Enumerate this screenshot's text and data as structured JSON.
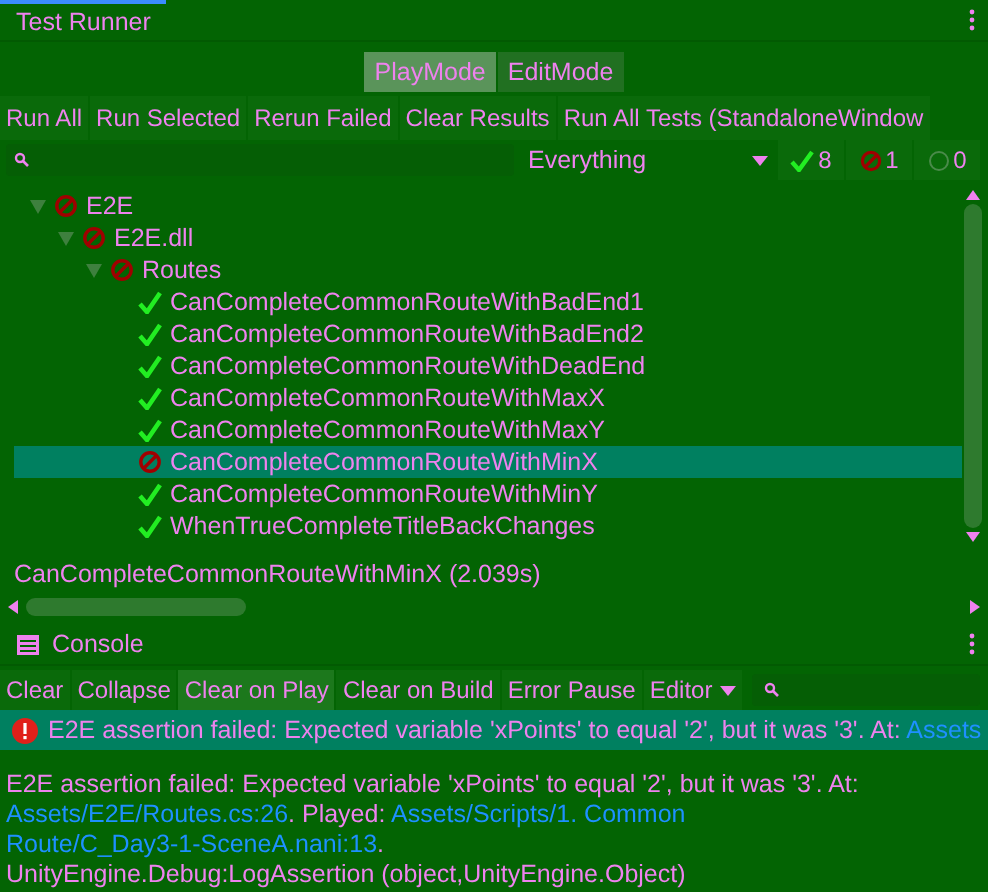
{
  "test_runner": {
    "tab": "Test Runner",
    "modes": [
      {
        "label": "PlayMode",
        "selected": true
      },
      {
        "label": "EditMode",
        "selected": false
      }
    ],
    "toolbar": [
      "Run All",
      "Run Selected",
      "Rerun Failed",
      "Clear Results",
      "Run All Tests (StandaloneWindow"
    ],
    "filter": {
      "dropdown": "Everything",
      "passed_count": "8",
      "failed_count": "1",
      "skipped_count": "0"
    },
    "tree": [
      {
        "label": "E2E",
        "passed": false,
        "expanded": true,
        "selected": false,
        "children": [
          {
            "label": "E2E.dll",
            "passed": false,
            "expanded": true,
            "selected": false,
            "children": [
              {
                "label": "Routes",
                "passed": false,
                "expanded": true,
                "selected": false,
                "children": [
                  {
                    "label": "CanCompleteCommonRouteWithBadEnd1",
                    "passed": true,
                    "selected": false
                  },
                  {
                    "label": "CanCompleteCommonRouteWithBadEnd2",
                    "passed": true,
                    "selected": false
                  },
                  {
                    "label": "CanCompleteCommonRouteWithDeadEnd",
                    "passed": true,
                    "selected": false
                  },
                  {
                    "label": "CanCompleteCommonRouteWithMaxX",
                    "passed": true,
                    "selected": false
                  },
                  {
                    "label": "CanCompleteCommonRouteWithMaxY",
                    "passed": true,
                    "selected": false
                  },
                  {
                    "label": "CanCompleteCommonRouteWithMinX",
                    "passed": false,
                    "selected": true
                  },
                  {
                    "label": "CanCompleteCommonRouteWithMinY",
                    "passed": true,
                    "selected": false
                  },
                  {
                    "label": "WhenTrueCompleteTitleBackChanges",
                    "passed": true,
                    "selected": false
                  }
                ]
              }
            ]
          }
        ]
      }
    ],
    "status_line": "CanCompleteCommonRouteWithMinX (2.039s)"
  },
  "console": {
    "tab": "Console",
    "toolbar": [
      {
        "label": "Clear",
        "on": false
      },
      {
        "label": "Collapse",
        "on": false
      },
      {
        "label": "Clear on Play",
        "on": true
      },
      {
        "label": "Clear on Build",
        "on": false
      },
      {
        "label": "Error Pause",
        "on": false
      }
    ],
    "editor_dropdown": "Editor",
    "entries": [
      {
        "kind": "error",
        "selected": true,
        "parts": [
          {
            "kind": "text",
            "text": "E2E assertion failed: Expected variable 'xPoints' to equal '2', but it was '3'. At: "
          },
          {
            "kind": "link",
            "text": "Assets"
          }
        ]
      }
    ],
    "detail": [
      {
        "kind": "text",
        "text": "E2E assertion failed: Expected variable 'xPoints' to equal '2', but it was '3'. At: "
      },
      {
        "kind": "link",
        "text": "Assets/E2E/Routes.cs:26"
      },
      {
        "kind": "text",
        "text": ". Played: "
      },
      {
        "kind": "link",
        "text": "Assets/Scripts/1. Common"
      },
      {
        "kind": "break"
      },
      {
        "kind": "link",
        "text": "Route/C_Day3-1-SceneA.nani:13"
      },
      {
        "kind": "text",
        "text": "."
      },
      {
        "kind": "break"
      },
      {
        "kind": "text",
        "text": "UnityEngine.Debug:LogAssertion (object,UnityEngine.Object)"
      }
    ]
  }
}
